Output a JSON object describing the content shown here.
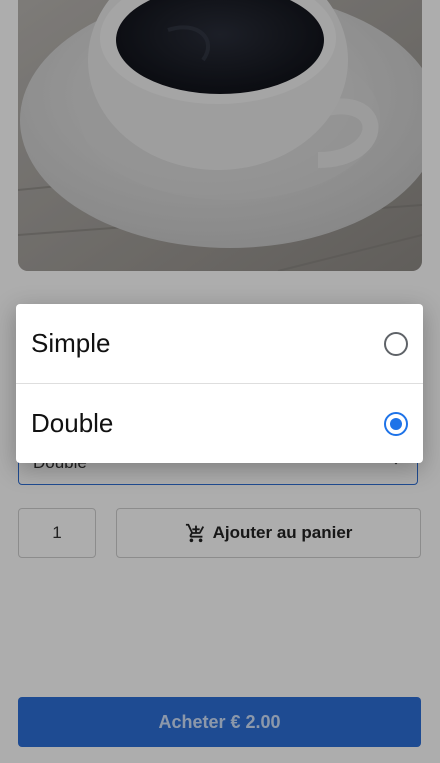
{
  "product": {
    "image_icon": "coffee-cup-photo"
  },
  "variant_select": {
    "value": "Double"
  },
  "quantity": {
    "value": "1"
  },
  "add_to_cart": {
    "label": "Ajouter au panier",
    "icon": "cart-icon"
  },
  "buy": {
    "label": "Acheter € 2.00"
  },
  "dialog": {
    "options": [
      {
        "label": "Simple",
        "selected": false
      },
      {
        "label": "Double",
        "selected": true
      }
    ]
  },
  "colors": {
    "accent": "#1e73e8",
    "buy_button": "#2d6fd8",
    "scrim": "rgba(0,0,0,0.32)"
  }
}
